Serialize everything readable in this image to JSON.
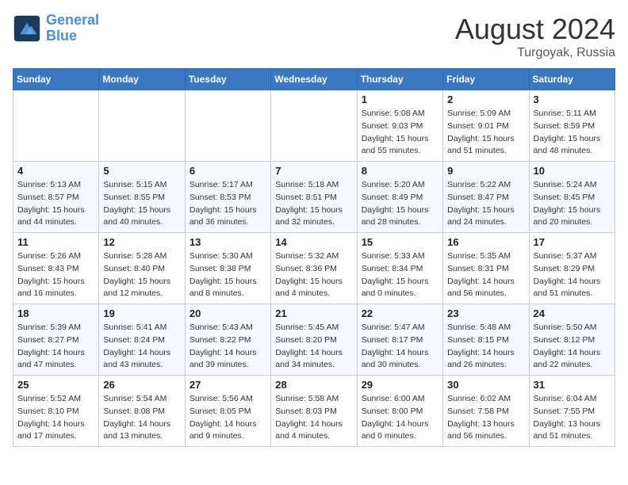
{
  "header": {
    "logo_line1": "General",
    "logo_line2": "Blue",
    "month_year": "August 2024",
    "location": "Turgoyak, Russia"
  },
  "days_of_week": [
    "Sunday",
    "Monday",
    "Tuesday",
    "Wednesday",
    "Thursday",
    "Friday",
    "Saturday"
  ],
  "weeks": [
    [
      {
        "day": "",
        "info": ""
      },
      {
        "day": "",
        "info": ""
      },
      {
        "day": "",
        "info": ""
      },
      {
        "day": "",
        "info": ""
      },
      {
        "day": "1",
        "info": "Sunrise: 5:08 AM\nSunset: 9:03 PM\nDaylight: 15 hours\nand 55 minutes."
      },
      {
        "day": "2",
        "info": "Sunrise: 5:09 AM\nSunset: 9:01 PM\nDaylight: 15 hours\nand 51 minutes."
      },
      {
        "day": "3",
        "info": "Sunrise: 5:11 AM\nSunset: 8:59 PM\nDaylight: 15 hours\nand 48 minutes."
      }
    ],
    [
      {
        "day": "4",
        "info": "Sunrise: 5:13 AM\nSunset: 8:57 PM\nDaylight: 15 hours\nand 44 minutes."
      },
      {
        "day": "5",
        "info": "Sunrise: 5:15 AM\nSunset: 8:55 PM\nDaylight: 15 hours\nand 40 minutes."
      },
      {
        "day": "6",
        "info": "Sunrise: 5:17 AM\nSunset: 8:53 PM\nDaylight: 15 hours\nand 36 minutes."
      },
      {
        "day": "7",
        "info": "Sunrise: 5:18 AM\nSunset: 8:51 PM\nDaylight: 15 hours\nand 32 minutes."
      },
      {
        "day": "8",
        "info": "Sunrise: 5:20 AM\nSunset: 8:49 PM\nDaylight: 15 hours\nand 28 minutes."
      },
      {
        "day": "9",
        "info": "Sunrise: 5:22 AM\nSunset: 8:47 PM\nDaylight: 15 hours\nand 24 minutes."
      },
      {
        "day": "10",
        "info": "Sunrise: 5:24 AM\nSunset: 8:45 PM\nDaylight: 15 hours\nand 20 minutes."
      }
    ],
    [
      {
        "day": "11",
        "info": "Sunrise: 5:26 AM\nSunset: 8:43 PM\nDaylight: 15 hours\nand 16 minutes."
      },
      {
        "day": "12",
        "info": "Sunrise: 5:28 AM\nSunset: 8:40 PM\nDaylight: 15 hours\nand 12 minutes."
      },
      {
        "day": "13",
        "info": "Sunrise: 5:30 AM\nSunset: 8:38 PM\nDaylight: 15 hours\nand 8 minutes."
      },
      {
        "day": "14",
        "info": "Sunrise: 5:32 AM\nSunset: 8:36 PM\nDaylight: 15 hours\nand 4 minutes."
      },
      {
        "day": "15",
        "info": "Sunrise: 5:33 AM\nSunset: 8:34 PM\nDaylight: 15 hours\nand 0 minutes."
      },
      {
        "day": "16",
        "info": "Sunrise: 5:35 AM\nSunset: 8:31 PM\nDaylight: 14 hours\nand 56 minutes."
      },
      {
        "day": "17",
        "info": "Sunrise: 5:37 AM\nSunset: 8:29 PM\nDaylight: 14 hours\nand 51 minutes."
      }
    ],
    [
      {
        "day": "18",
        "info": "Sunrise: 5:39 AM\nSunset: 8:27 PM\nDaylight: 14 hours\nand 47 minutes."
      },
      {
        "day": "19",
        "info": "Sunrise: 5:41 AM\nSunset: 8:24 PM\nDaylight: 14 hours\nand 43 minutes."
      },
      {
        "day": "20",
        "info": "Sunrise: 5:43 AM\nSunset: 8:22 PM\nDaylight: 14 hours\nand 39 minutes."
      },
      {
        "day": "21",
        "info": "Sunrise: 5:45 AM\nSunset: 8:20 PM\nDaylight: 14 hours\nand 34 minutes."
      },
      {
        "day": "22",
        "info": "Sunrise: 5:47 AM\nSunset: 8:17 PM\nDaylight: 14 hours\nand 30 minutes."
      },
      {
        "day": "23",
        "info": "Sunrise: 5:48 AM\nSunset: 8:15 PM\nDaylight: 14 hours\nand 26 minutes."
      },
      {
        "day": "24",
        "info": "Sunrise: 5:50 AM\nSunset: 8:12 PM\nDaylight: 14 hours\nand 22 minutes."
      }
    ],
    [
      {
        "day": "25",
        "info": "Sunrise: 5:52 AM\nSunset: 8:10 PM\nDaylight: 14 hours\nand 17 minutes."
      },
      {
        "day": "26",
        "info": "Sunrise: 5:54 AM\nSunset: 8:08 PM\nDaylight: 14 hours\nand 13 minutes."
      },
      {
        "day": "27",
        "info": "Sunrise: 5:56 AM\nSunset: 8:05 PM\nDaylight: 14 hours\nand 9 minutes."
      },
      {
        "day": "28",
        "info": "Sunrise: 5:58 AM\nSunset: 8:03 PM\nDaylight: 14 hours\nand 4 minutes."
      },
      {
        "day": "29",
        "info": "Sunrise: 6:00 AM\nSunset: 8:00 PM\nDaylight: 14 hours\nand 0 minutes."
      },
      {
        "day": "30",
        "info": "Sunrise: 6:02 AM\nSunset: 7:58 PM\nDaylight: 13 hours\nand 56 minutes."
      },
      {
        "day": "31",
        "info": "Sunrise: 6:04 AM\nSunset: 7:55 PM\nDaylight: 13 hours\nand 51 minutes."
      }
    ]
  ]
}
